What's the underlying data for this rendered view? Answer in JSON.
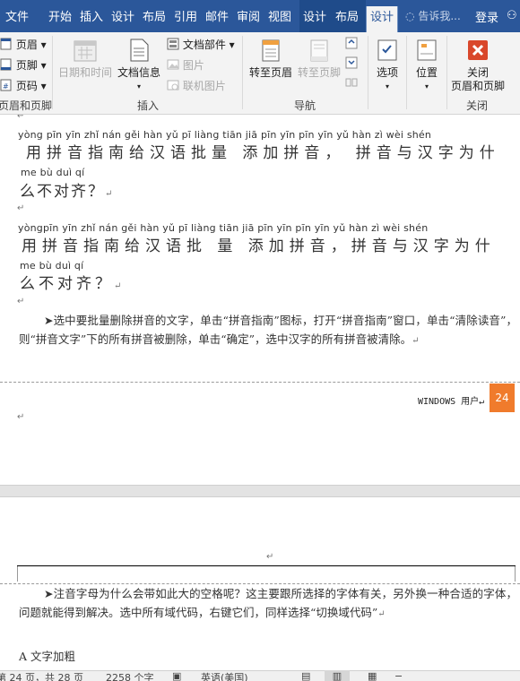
{
  "tabs": [
    "文件",
    "开始",
    "插入",
    "设计",
    "布局",
    "引用",
    "邮件",
    "审阅",
    "视图",
    "设计",
    "布局",
    "设计"
  ],
  "tell_me": "告诉我...",
  "login": "登录",
  "ribbon": {
    "header_footer": {
      "header": "页眉",
      "footer": "页脚",
      "page_number": "页码",
      "group": "页眉和页脚"
    },
    "insert": {
      "date_time": "日期和时间",
      "doc_info": "文档信息",
      "doc_parts": "文档部件",
      "picture": "图片",
      "online_picture": "联机图片",
      "group": "插入"
    },
    "navigation": {
      "goto_header": "转至页眉",
      "goto_footer": "转至页脚",
      "group": "导航"
    },
    "options": {
      "label": "选项"
    },
    "position": {
      "label": "位置"
    },
    "close": {
      "line1": "关闭",
      "line2": "页眉和页脚",
      "group": "关闭"
    }
  },
  "doc": {
    "block1": {
      "pinyin1": "yòng pīn yīn zhǐ nán gěi hàn yǔ pī liàng tiān jiā pīn yīn      pīn yīn yǔ hàn zì wèi shén",
      "hanzi1": "用拼音指南给汉语批量 添加拼音， 拼音与汉字为什",
      "pinyin2": "me bù duì qí",
      "hanzi2": "么不对齐？"
    },
    "block2": {
      "pinyin1": "yòngpīn yīn zhǐ nán gěi hàn yǔ pī liàng tiān jiā pīn yīn    pīn yīn yǔ hàn zì wèi shén",
      "hanzi1": "用拼音指南给汉语批 量 添加拼音，拼音与汉字为什",
      "pinyin2": " me  bù duì qí",
      "hanzi2": "么不对齐？"
    },
    "para1": "➤选中要批量删除拼音的文字，单击“拼音指南”图标，打开“拼音指南”窗口，单击“清除读音”，则“拼音文字”下的所有拼音被删除，单击“确定”，选中汉字的所有拼音被清除。",
    "footer_label": "WINDOWS 用户",
    "page_badge": "24",
    "para2": "➤注音字母为什么会带如此大的空格呢？这主要跟所选择的字体有关，另外换一种合适的字体，问题就能得到解决。选中所有域代码，右键它们，同样选择“切换域代码”",
    "para3_partial": "A 文字加粗"
  },
  "status": {
    "page": "第 24 页，共 28 页",
    "words": "2258 个字",
    "language": "英语(美国)"
  }
}
